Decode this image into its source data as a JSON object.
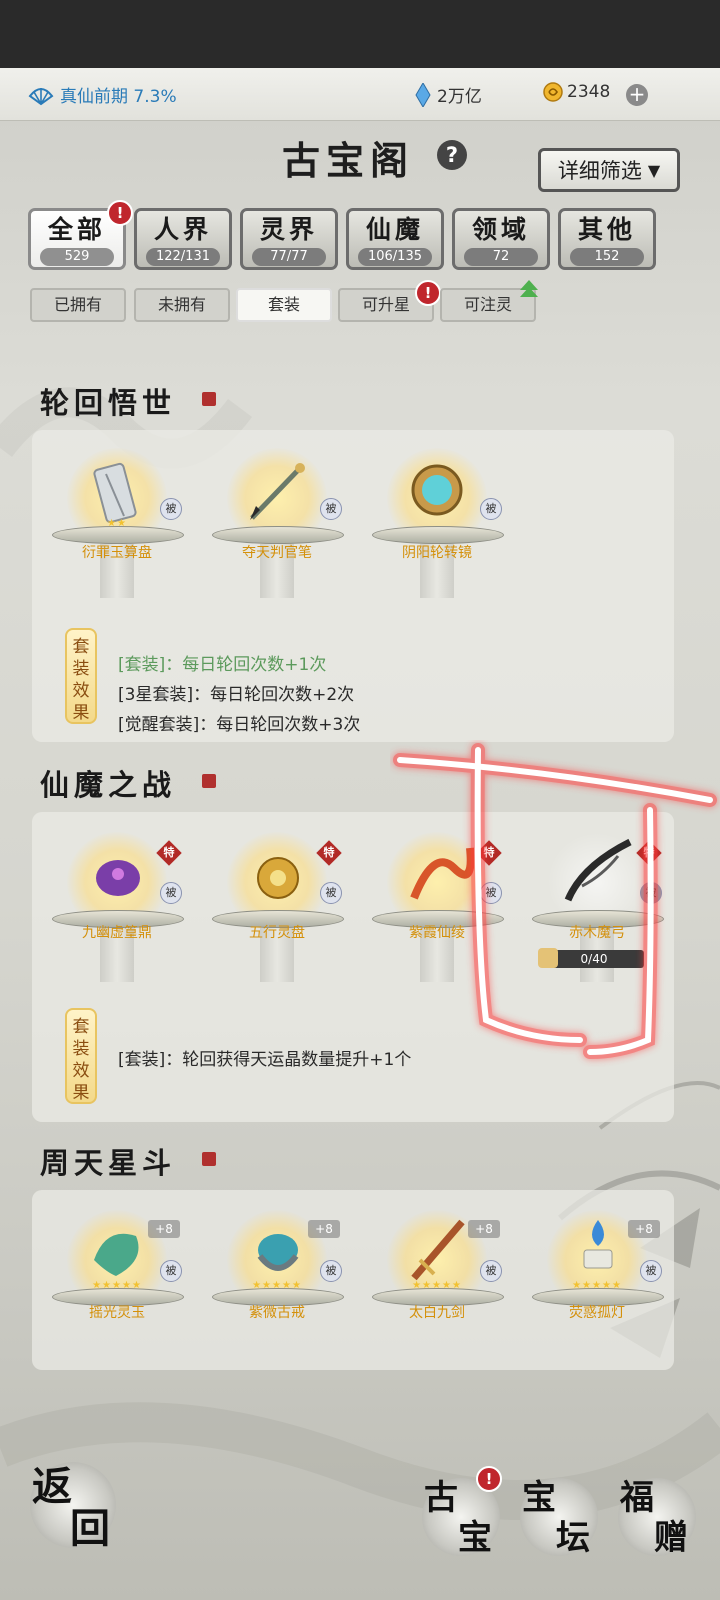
{
  "topbar": {
    "realm_label": "真仙前期 7.3%",
    "crystal_value": "2万亿",
    "coin_value": "2348",
    "plus_label": "+"
  },
  "header": {
    "title": "古宝阁",
    "help_label": "?",
    "filter_label": "详细筛选",
    "filter_caret": "▼"
  },
  "tabs": [
    {
      "label": "全部",
      "count": "529",
      "active": true
    },
    {
      "label": "人界",
      "count": "122/131"
    },
    {
      "label": "灵界",
      "count": "77/77"
    },
    {
      "label": "仙魔",
      "count": "106/135"
    },
    {
      "label": "领域",
      "count": "72"
    },
    {
      "label": "其他",
      "count": "152"
    }
  ],
  "chips": [
    {
      "label": "已拥有"
    },
    {
      "label": "未拥有"
    },
    {
      "label": "套装",
      "active": true
    },
    {
      "label": "可升星"
    },
    {
      "label": "可注灵"
    }
  ],
  "badge_text": "!",
  "sections": [
    {
      "title": "轮回悟世",
      "items": [
        {
          "name": "衍罪玉算盘",
          "tag": "被",
          "stars": "★★"
        },
        {
          "name": "夺天判官笔",
          "tag": "被"
        },
        {
          "name": "阴阳轮转镜",
          "tag": "被"
        }
      ],
      "set_label": "套装效果",
      "effects": [
        "[套装]：每日轮回次数+1次",
        "[3星套装]：每日轮回次数+2次",
        "[觉醒套装]：每日轮回次数+3次"
      ]
    },
    {
      "title": "仙魔之战",
      "items": [
        {
          "name": "九幽虚篁鼎",
          "tag": "被",
          "special": "特"
        },
        {
          "name": "五行灵盘",
          "tag": "被",
          "special": "特"
        },
        {
          "name": "紫霞仙绫",
          "tag": "被",
          "special": "特"
        },
        {
          "name": "赤木魔弓",
          "tag": "被",
          "special": "特",
          "progress": "0/40"
        }
      ],
      "set_label": "套装效果",
      "effects": [
        "[套装]：轮回获得天运晶数量提升+1个"
      ]
    },
    {
      "title": "周天星斗",
      "items": [
        {
          "name": "摇光灵玉",
          "tag": "被",
          "plus": "+8",
          "stars": "★★★★★"
        },
        {
          "name": "紫微古戒",
          "tag": "被",
          "plus": "+8",
          "stars": "★★★★★"
        },
        {
          "name": "太白九剑",
          "tag": "被",
          "plus": "+8",
          "stars": "★★★★★"
        },
        {
          "name": "荧惑孤灯",
          "tag": "被",
          "plus": "+8",
          "stars": "★★★★★"
        }
      ]
    }
  ],
  "bottom": {
    "back_1": "返",
    "back_2": "回",
    "gubao_1": "古",
    "gubao_2": "宝",
    "baotan_1": "宝",
    "baotan_2": "坛",
    "fuzeng_1": "福",
    "fuzeng_2": "赠"
  },
  "colors": {
    "accent_red": "#c0262d",
    "item_name": "#d4900a",
    "realm_blue": "#2a7bb8",
    "effect_green": "#5c9a5c"
  }
}
